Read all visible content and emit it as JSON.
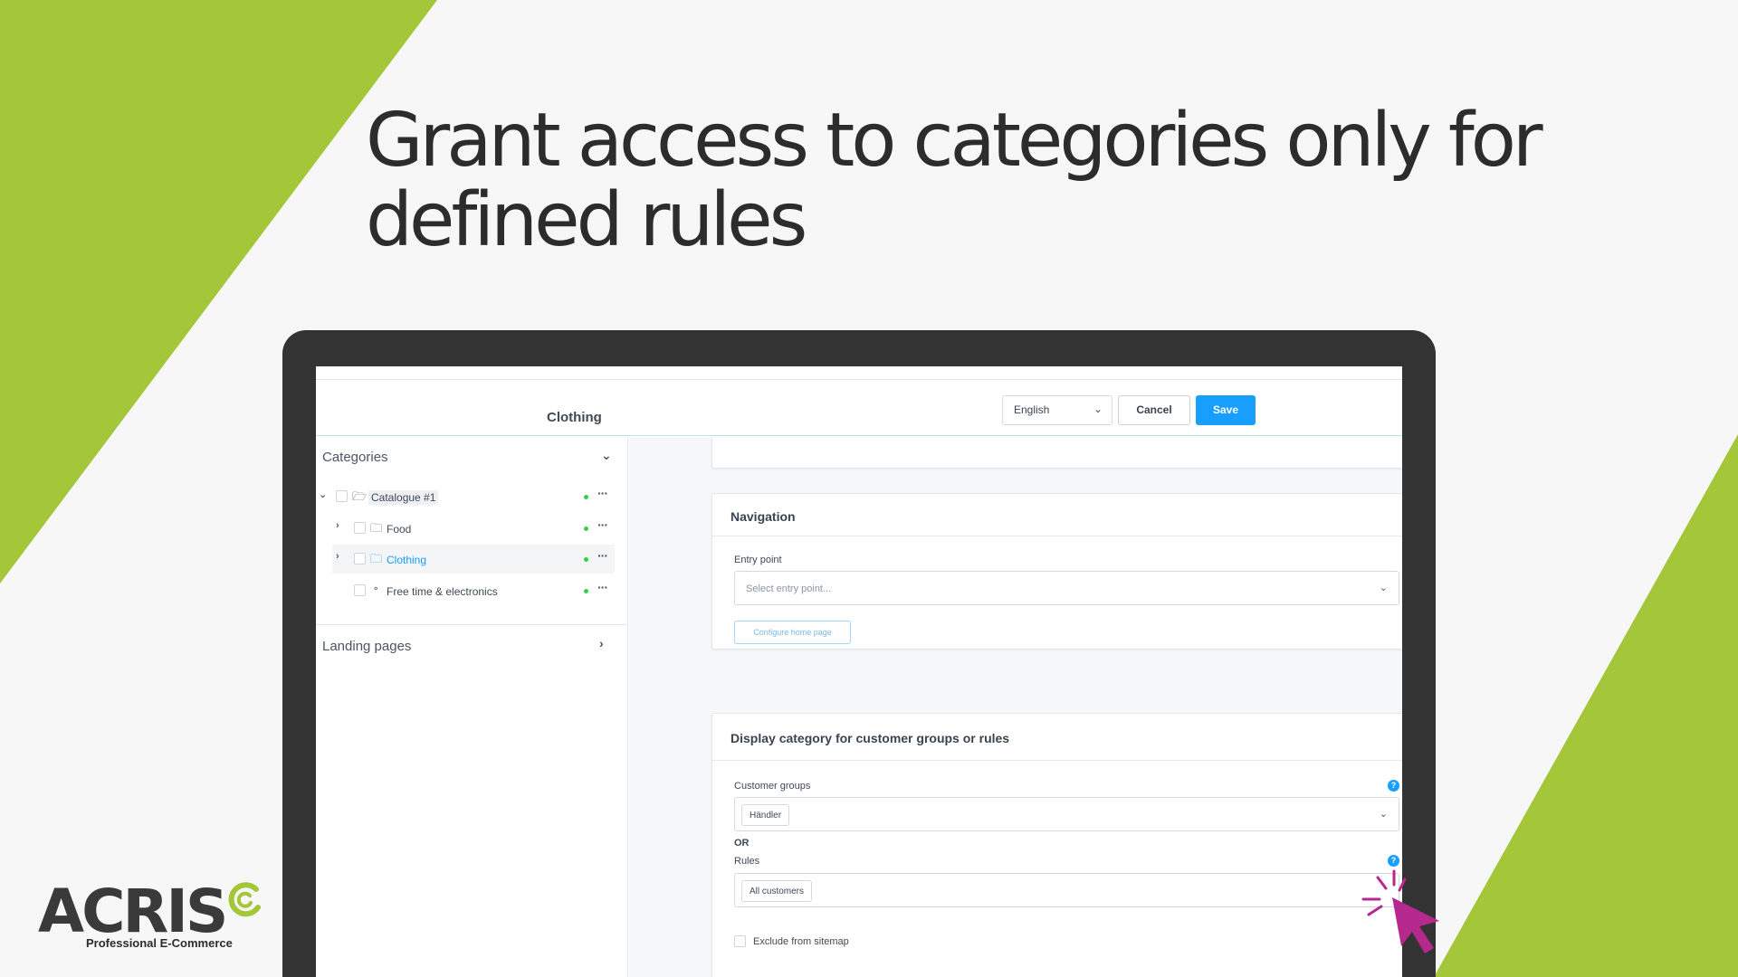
{
  "headline": "Grant access to categories only for defined rules",
  "colors": {
    "brand_green": "#a4c639",
    "primary_blue": "#189eff",
    "cursor_magenta": "#b5298f"
  },
  "toolbar": {
    "page_title": "Clothing",
    "language": "English",
    "cancel_label": "Cancel",
    "save_label": "Save"
  },
  "sidebar": {
    "categories_title": "Categories",
    "tree": [
      {
        "label": "Catalogue #1",
        "icon": "folder-open-icon",
        "expanded": true
      },
      {
        "label": "Food",
        "icon": "folder-icon",
        "expanded": false
      },
      {
        "label": "Clothing",
        "icon": "folder-icon",
        "expanded": false,
        "active": true
      },
      {
        "label": "Free time & electronics",
        "icon": "circle-icon",
        "expanded": false
      }
    ],
    "landing_pages_title": "Landing pages"
  },
  "navigation_card": {
    "title": "Navigation",
    "entry_point_label": "Entry point",
    "entry_point_placeholder": "Select entry point...",
    "configure_button": "Configure home page"
  },
  "display_card": {
    "title": "Display category for customer groups or rules",
    "customer_groups_label": "Customer groups",
    "customer_groups_value": "Händler",
    "or_label": "OR",
    "rules_label": "Rules",
    "rules_value": "All customers",
    "exclude_sitemap_label": "Exclude from sitemap"
  },
  "logo": {
    "word": "ACRIS",
    "tagline": "Professional E-Commerce"
  }
}
